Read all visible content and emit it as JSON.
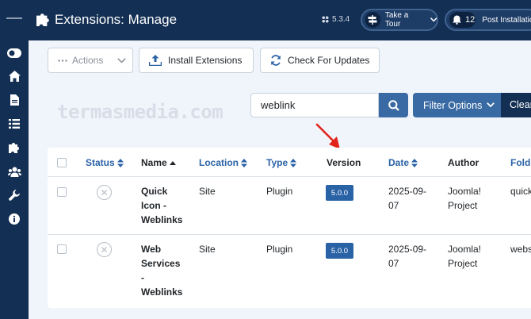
{
  "header": {
    "title": "Extensions: Manage",
    "version": "5.3.4",
    "take_tour": "Take a Tour",
    "notification_count": "12",
    "post_installation": "Post Installation"
  },
  "toolbar": {
    "actions": "Actions",
    "install": "Install Extensions",
    "check_updates": "Check For Updates"
  },
  "watermark": "termasmedia.com",
  "search": {
    "value": "weblink",
    "filter_options": "Filter Options",
    "clear": "Clear"
  },
  "table": {
    "headers": {
      "status": "Status",
      "name": "Name",
      "location": "Location",
      "type": "Type",
      "version": "Version",
      "date": "Date",
      "author": "Author",
      "folder": "Folder"
    },
    "rows": [
      {
        "name": [
          "Quick",
          "Icon -",
          "Weblinks"
        ],
        "location": "Site",
        "type": "Plugin",
        "version": "5.0.0",
        "date": [
          "2025-09-",
          "07"
        ],
        "author": [
          "Joomla!",
          "Project"
        ],
        "folder": "quickicon"
      },
      {
        "name": [
          "Web",
          "Services",
          "-",
          "Weblinks"
        ],
        "location": "Site",
        "type": "Plugin",
        "version": "5.0.0",
        "date": [
          "2025-09-",
          "07"
        ],
        "author": [
          "Joomla!",
          "Project"
        ],
        "folder": "webservices"
      }
    ]
  },
  "colors": {
    "navy": "#132f53",
    "link_blue": "#2a62a6",
    "button_blue": "#3a6aa3",
    "arrow_red": "#e2231a"
  }
}
